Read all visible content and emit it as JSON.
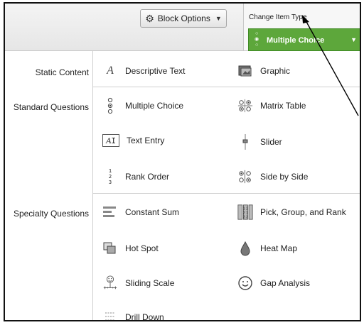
{
  "toolbar": {
    "block_options_label": "Block Options",
    "change_item_type_label": "Change Item Type",
    "current_type_label": "Multiple Choice"
  },
  "menu": {
    "categories": {
      "static": "Static Content",
      "standard": "Standard Questions",
      "specialty": "Specialty Questions"
    },
    "items": {
      "descriptive_text": "Descriptive Text",
      "graphic": "Graphic",
      "multiple_choice": "Multiple Choice",
      "matrix_table": "Matrix Table",
      "text_entry": "Text Entry",
      "slider": "Slider",
      "rank_order": "Rank Order",
      "side_by_side": "Side by Side",
      "constant_sum": "Constant Sum",
      "pick_group_rank": "Pick, Group, and Rank",
      "hot_spot": "Hot Spot",
      "heat_map": "Heat Map",
      "sliding_scale": "Sliding Scale",
      "gap_analysis": "Gap Analysis",
      "drill_down": "Drill Down"
    }
  },
  "colors": {
    "dropdown_green": "#5da73b",
    "border": "#cfcfcf"
  }
}
